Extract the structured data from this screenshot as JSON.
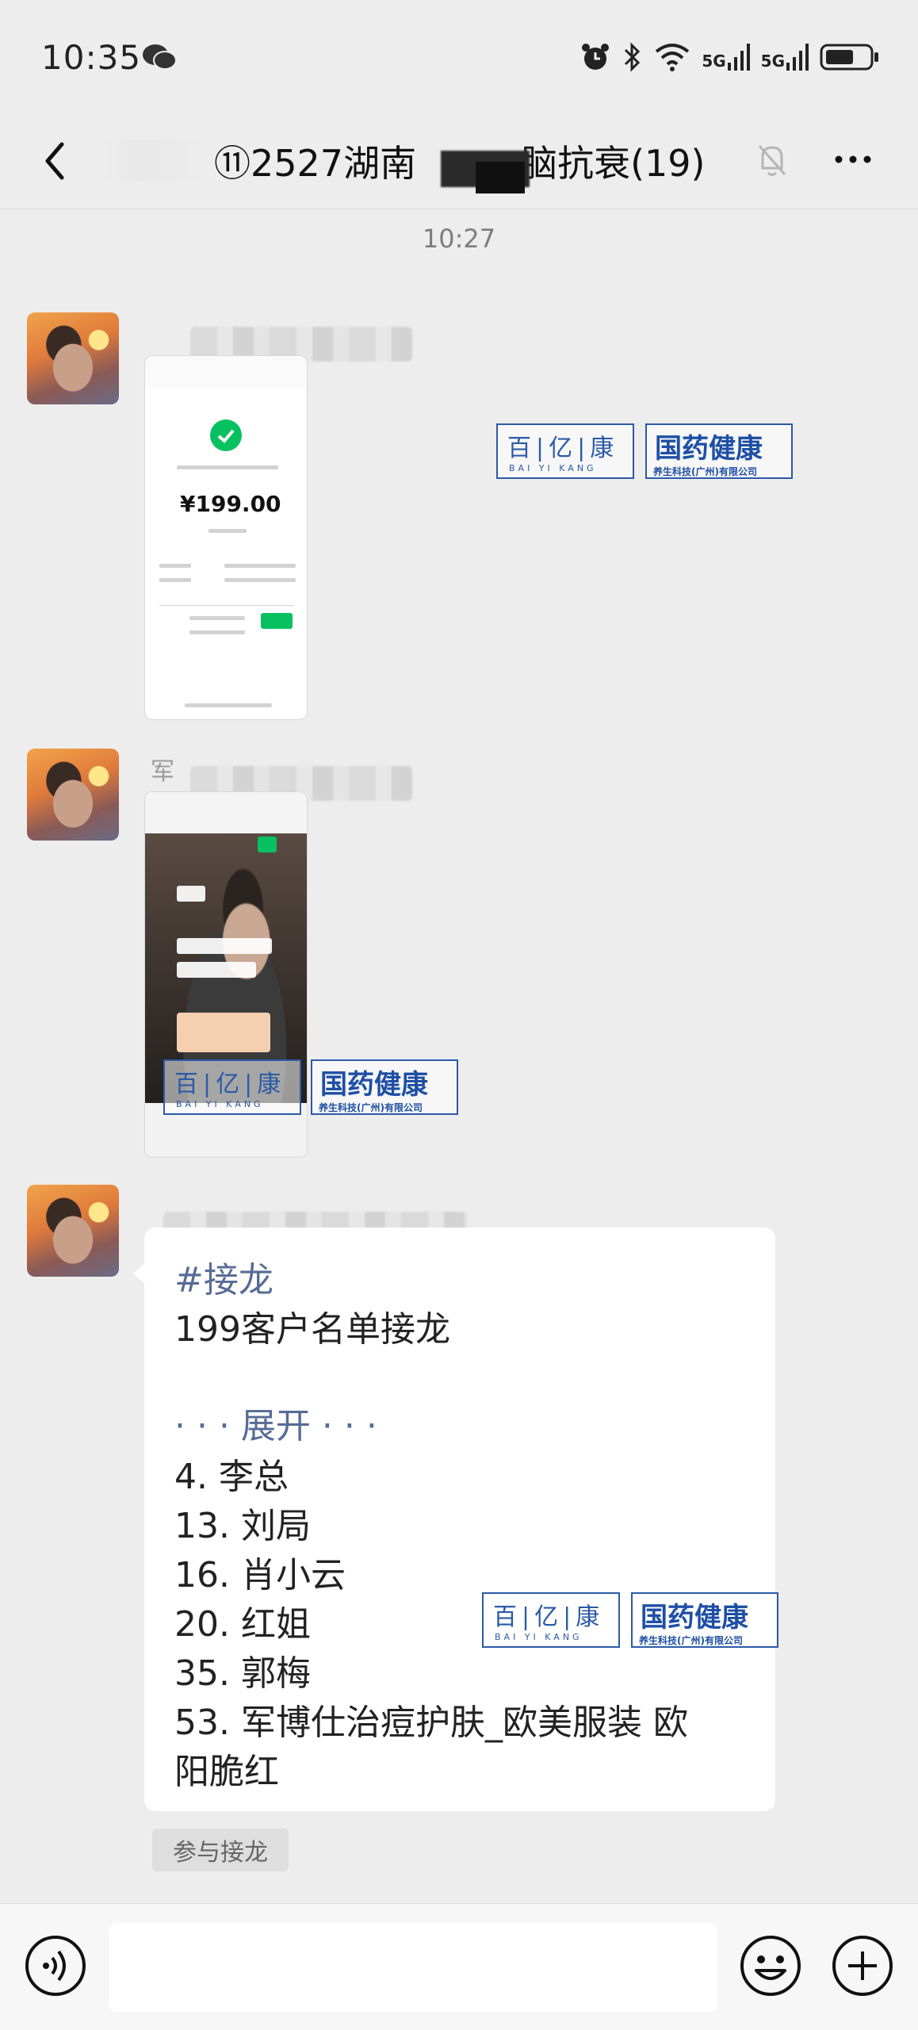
{
  "status_bar": {
    "time": "10:35",
    "network_1": "5G",
    "network_2": "5G"
  },
  "nav": {
    "title": "⑪2527湖南",
    "title_suffix": "脑抗衰(19)"
  },
  "timestamp": "10:27",
  "messages": [
    {
      "type": "image",
      "sender_visible_char": "",
      "content": {
        "amount": "¥199.00"
      }
    },
    {
      "type": "image",
      "sender_visible_char": "军"
    },
    {
      "type": "text",
      "sender_visible_char": "",
      "hashtag": "#接龙",
      "title": "199客户名单接龙",
      "expand": "· · · 展开 · · ·",
      "entries": [
        "4. 李总",
        "13. 刘局",
        "16. 肖小云",
        "20. 红姐",
        "35. 郭梅",
        "53. 军博仕治痘护肤_欧美服装 欧",
        "阳脆红"
      ]
    }
  ],
  "join_button": "参与接龙",
  "watermark": {
    "left_cn": "百|亿|康",
    "left_en": "BAI YI KANG",
    "right_cn": "国药健康",
    "right_sub": "养生科技(广州)有限公司"
  },
  "icons": {
    "back": "back-arrow-icon",
    "mute": "bell-muted-icon",
    "more": "ellipsis-icon",
    "voice": "voice-icon",
    "emoji": "emoji-icon",
    "plus": "plus-icon"
  },
  "colors": {
    "background": "#ededed",
    "link": "#576b95",
    "wechat_green": "#07c160",
    "watermark_blue": "#2b5aa8"
  }
}
